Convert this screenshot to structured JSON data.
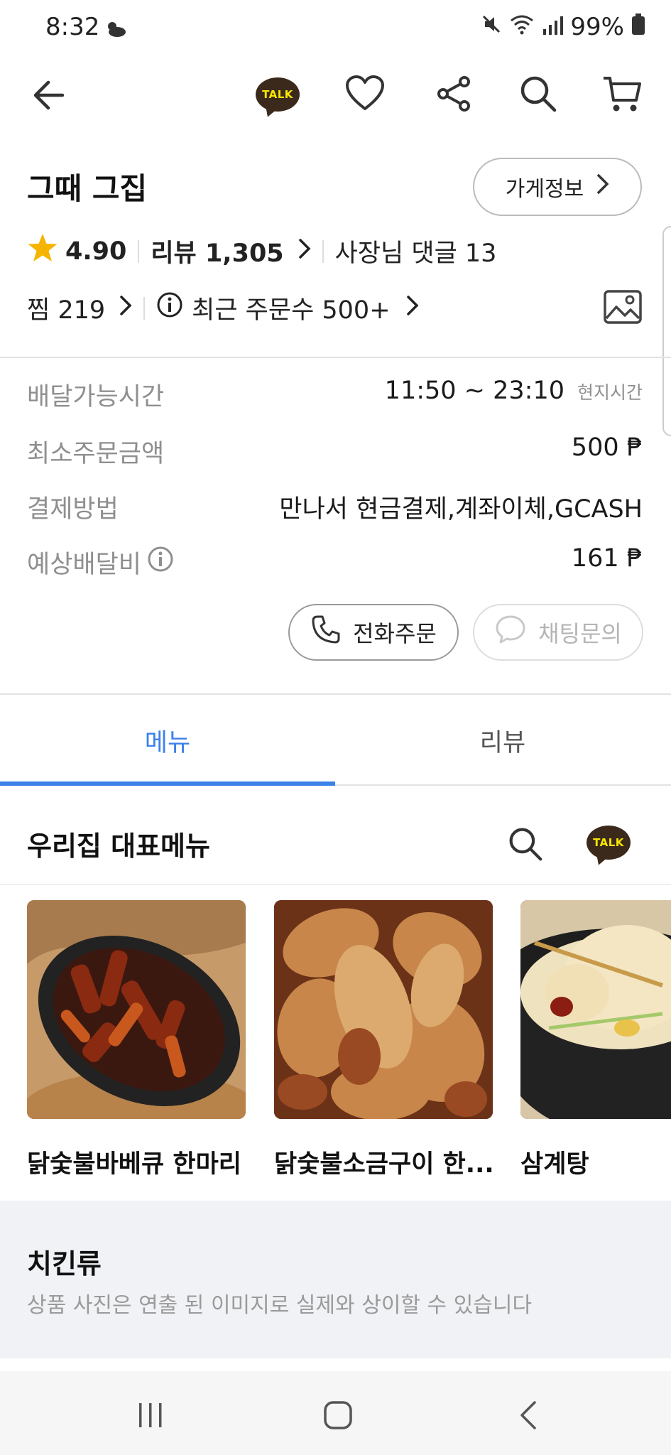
{
  "status_bar": {
    "time": "8:32",
    "battery": "99%"
  },
  "header": {
    "talk_label": "TALK"
  },
  "store": {
    "name": "그때 그집",
    "info_button": "가게정보",
    "rating": "4.90",
    "review_label": "리뷰 1,305",
    "owner_reply": "사장님 댓글 13",
    "likes": "찜 219",
    "recent_orders": "최근 주문수 500+"
  },
  "details": {
    "hours_label": "배달가능시간",
    "hours_value": "11:50 ~ 23:10",
    "hours_note": "현지시간",
    "min_order_label": "최소주문금액",
    "min_order_value": "500 ₱",
    "payment_label": "결제방법",
    "payment_value": "만나서 현금결제,계좌이체,GCASH",
    "fee_label": "예상배달비",
    "fee_value": "161 ₱"
  },
  "actions": {
    "phone_order": "전화주문",
    "chat_inquiry": "채팅문의"
  },
  "tabs": [
    {
      "label": "메뉴",
      "active": true
    },
    {
      "label": "리뷰",
      "active": false
    }
  ],
  "featured": {
    "title": "우리집 대표메뉴",
    "talk_label": "TALK",
    "items": [
      {
        "name": "닭숯불바베큐 한마리"
      },
      {
        "name": "닭숯불소금구이 한..."
      },
      {
        "name": "삼계탕"
      }
    ]
  },
  "category": {
    "title": "치킨류",
    "notice": "상품 사진은 연출 된 이미지로 실제와 상이할 수 있습니다"
  },
  "colors": {
    "accent_blue": "#3b82e8",
    "star": "#f5b400",
    "talk_bg": "#3b2a1c",
    "talk_text": "#f7e600"
  }
}
